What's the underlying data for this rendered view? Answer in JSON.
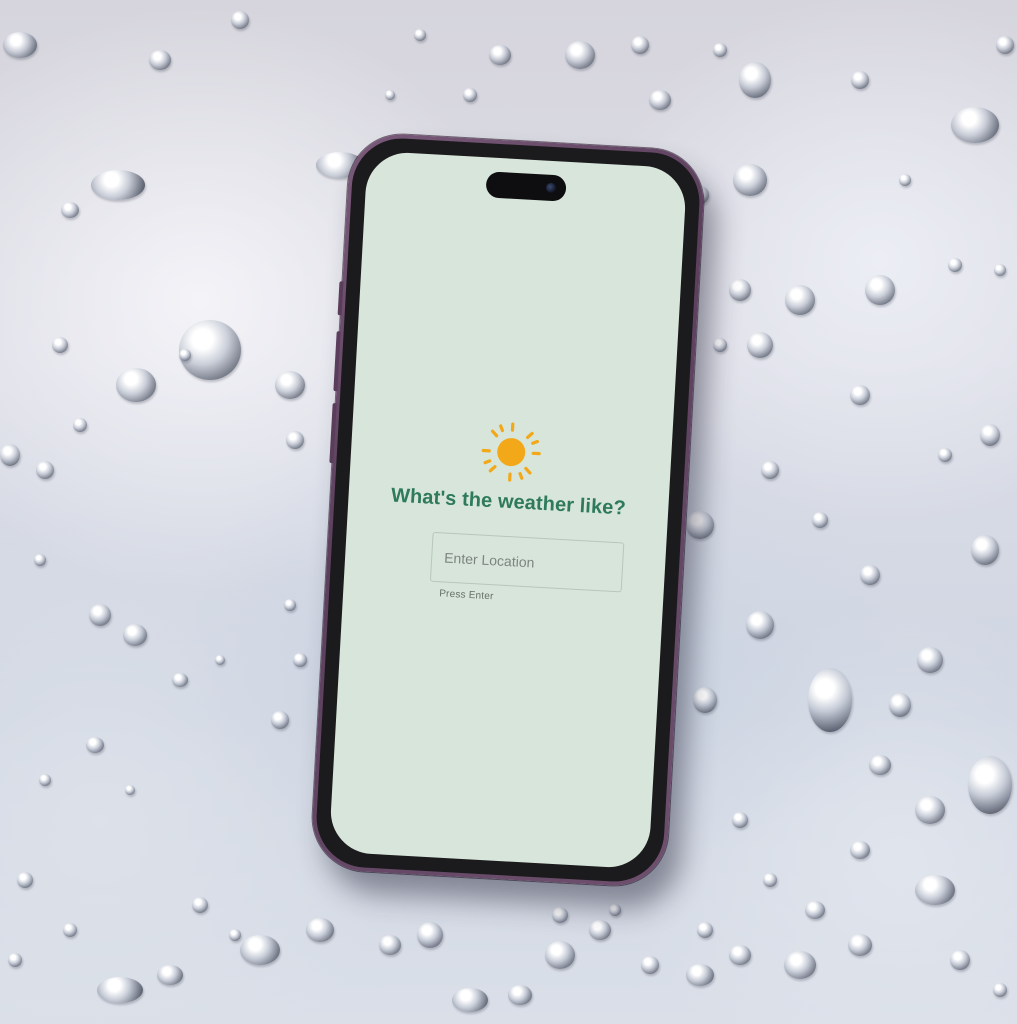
{
  "app": {
    "headline": "What's the weather like?",
    "icon": "sun-icon"
  },
  "search": {
    "placeholder": "Enter Location",
    "value": "",
    "hint": "Press Enter"
  },
  "colors": {
    "screen_background": "#d7e5da",
    "headline": "#2e7a5a",
    "sun": "#f2a818",
    "phone_frame": "#5b3f5c"
  }
}
